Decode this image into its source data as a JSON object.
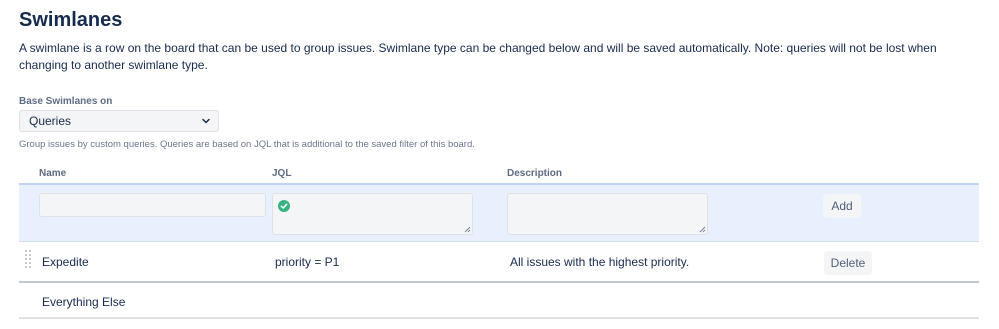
{
  "page": {
    "title": "Swimlanes",
    "description": "A swimlane is a row on the board that can be used to group issues. Swimlane type can be changed below and will be saved automatically. Note: queries will not be lost when changing to another swimlane type."
  },
  "base": {
    "label": "Base Swimlanes on",
    "selected": "Queries",
    "help": "Group issues by custom queries. Queries are based on JQL that is additional to the saved filter of this board."
  },
  "table": {
    "columns": {
      "name": "Name",
      "jql": "JQL",
      "description": "Description"
    },
    "add_row": {
      "name_value": "",
      "jql_value": "",
      "description_value": "",
      "jql_status_icon": "check-circle-icon",
      "add_label": "Add"
    },
    "rows": [
      {
        "name": "Expedite",
        "jql": "priority = P1",
        "description": "All issues with the highest priority.",
        "delete_label": "Delete"
      },
      {
        "name": "Everything Else",
        "jql": "",
        "description": "",
        "delete_label": ""
      }
    ]
  },
  "colors": {
    "add_row_bg": "#e9f0fd",
    "success": "#36b37e",
    "text": "#172b4d"
  }
}
